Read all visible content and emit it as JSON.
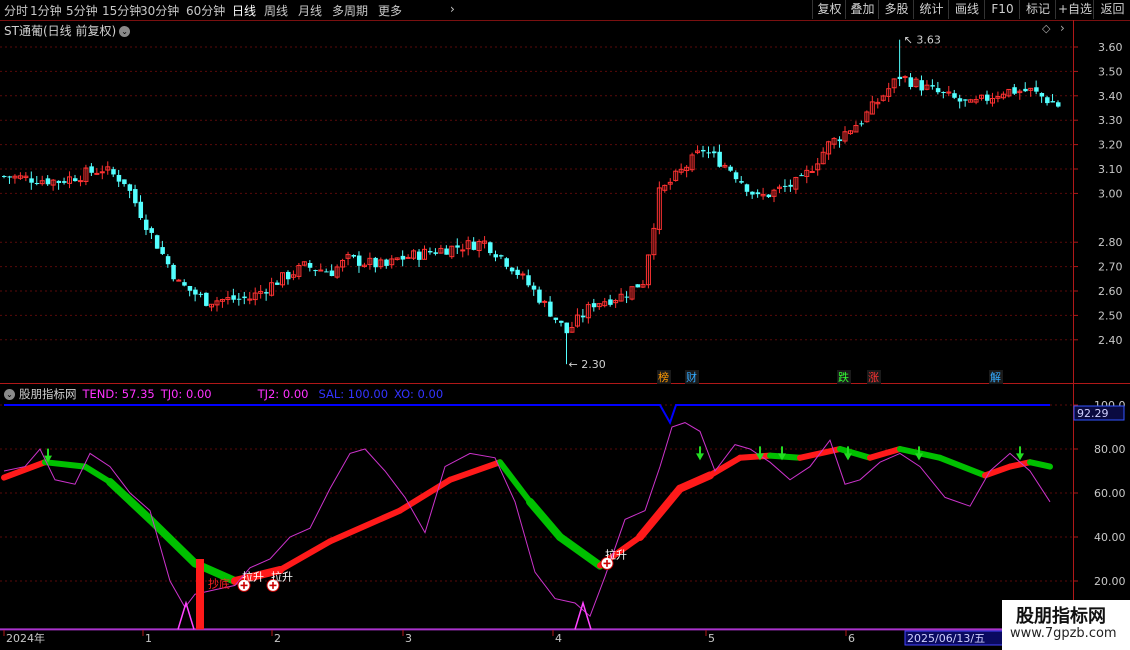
{
  "toolbar": {
    "periods": [
      "分时",
      "1分钟",
      "5分钟",
      "15分钟",
      "30分钟",
      "60分钟",
      "日线",
      "周线",
      "月线",
      "多周期",
      "更多"
    ],
    "active_period": "日线",
    "right_buttons": [
      "复权",
      "叠加",
      "多股",
      "统计",
      "画线",
      "F10",
      "标记",
      "+自选",
      "返回"
    ]
  },
  "stock": {
    "title": "ST通葡(日线 前复权)"
  },
  "price_axis": {
    "ticks": [
      "3.60",
      "3.50",
      "3.40",
      "3.30",
      "3.20",
      "3.10",
      "3.00",
      "2.80",
      "2.70",
      "2.60",
      "2.50",
      "2.40"
    ]
  },
  "annotations": {
    "high": "3.63",
    "low": "2.30"
  },
  "event_badges": [
    {
      "text": "榜",
      "color": "#ff9900"
    },
    {
      "text": "财",
      "color": "#33aaff"
    },
    {
      "text": "跌",
      "color": "#33ff33"
    },
    {
      "text": "涨",
      "color": "#ff3333"
    },
    {
      "text": "解",
      "color": "#33aaff"
    }
  ],
  "indicator": {
    "name": "股朋指标网",
    "tend": "TEND: 57.35",
    "tj0": "TJ0: 0.00",
    "tj2": "TJ2: 0.00",
    "sal": "SAL: 100.00",
    "xo": "XO: 0.00",
    "axis_ticks": [
      "100.0",
      "80.00",
      "60.00",
      "40.00",
      "20.00"
    ],
    "current_value": "92.29",
    "signal_labels": [
      "抄底",
      "拉升",
      "拉升",
      "拉升"
    ]
  },
  "time_axis": {
    "labels": [
      "2024年",
      "1",
      "2",
      "3",
      "4",
      "5",
      "6"
    ],
    "cursor_date": "2025/06/13/五"
  },
  "watermark": {
    "title": "股朋指标网",
    "url": "www.7gpzb.com"
  },
  "colors": {
    "up": "#ff3232",
    "down": "#54ffff",
    "tend_up": "#ff1a1a",
    "tend_down": "#00c000",
    "sal": "#0000ff",
    "purple": "#cc33cc"
  }
}
